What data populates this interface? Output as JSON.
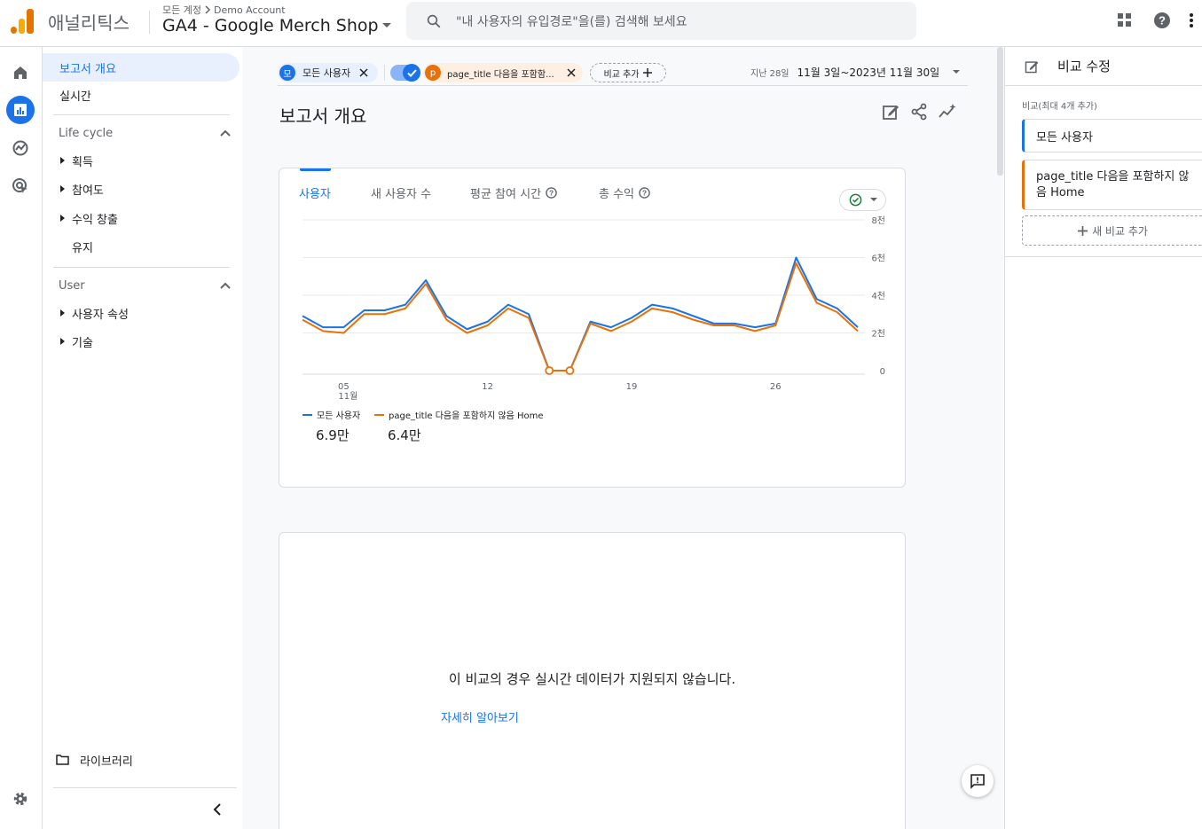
{
  "app": {
    "name": "애널리틱스"
  },
  "account": {
    "crumb_root": "모든 계정",
    "crumb_account": "Demo Account",
    "property": "GA4 - Google Merch Shop"
  },
  "search": {
    "placeholder": "\"내 사용자의 유입경로\"을(를) 검색해 보세요"
  },
  "nav": {
    "overview": "보고서 개요",
    "realtime": "실시간",
    "lifecycle": {
      "label": "Life cycle",
      "items": [
        "획득",
        "참여도",
        "수익 창출",
        "유지"
      ]
    },
    "user": {
      "label": "User",
      "items": [
        "사용자 속성",
        "기술"
      ]
    },
    "library": "라이브러리"
  },
  "chips": {
    "all_users_avatar": "모",
    "all_users": "모든 사용자",
    "page_avatar": "p",
    "page_filter": "page_title 다음을 포함함...",
    "add_compare": "비교 추가",
    "date_prefix": "지난 28일",
    "date_range": "11월 3일~2023년 11월 30일"
  },
  "page": {
    "title": "보고서 개요"
  },
  "tabs": [
    "사용자",
    "새 사용자 수",
    "평균 참여 시간",
    "총 수익"
  ],
  "chart_data": {
    "type": "line",
    "x_ticks": [
      {
        "day": 5,
        "label": "05",
        "sub": "11월"
      },
      {
        "day": 12,
        "label": "12",
        "sub": ""
      },
      {
        "day": 19,
        "label": "19",
        "sub": ""
      },
      {
        "day": 26,
        "label": "26",
        "sub": ""
      }
    ],
    "y_ticks": [
      {
        "value": 0,
        "label": "0"
      },
      {
        "value": 2000,
        "label": "2천"
      },
      {
        "value": 4000,
        "label": "4천"
      },
      {
        "value": 6000,
        "label": "6천"
      },
      {
        "value": 8000,
        "label": "8천"
      }
    ],
    "ylim": [
      0,
      8000
    ],
    "x": [
      3,
      4,
      5,
      6,
      7,
      8,
      9,
      10,
      11,
      12,
      13,
      14,
      15,
      16,
      17,
      18,
      19,
      20,
      21,
      22,
      23,
      24,
      25,
      26,
      27,
      28,
      29,
      30
    ],
    "series": [
      {
        "name": "모든 사용자",
        "color": "#1a73e8",
        "total": "6.9만",
        "values": [
          2900,
          2300,
          2300,
          3200,
          3200,
          3500,
          4800,
          2900,
          2200,
          2600,
          3500,
          3000,
          0,
          0,
          2600,
          2300,
          2800,
          3500,
          3300,
          2900,
          2500,
          2500,
          2300,
          2500,
          6000,
          3800,
          3300,
          2300
        ]
      },
      {
        "name": "page_title 다음을 포함하지 않음 Home",
        "color": "#e8710a",
        "total": "6.4만",
        "values": [
          2700,
          2100,
          2000,
          3000,
          3000,
          3300,
          4600,
          2700,
          2000,
          2400,
          3300,
          2800,
          0,
          0,
          2500,
          2100,
          2600,
          3300,
          3100,
          2700,
          2400,
          2400,
          2100,
          2400,
          5700,
          3600,
          3100,
          2100
        ]
      }
    ],
    "hollow_points": [
      15,
      16
    ]
  },
  "realtime": {
    "message": "이 비교의 경우 실시간 데이터가 지원되지 않습니다.",
    "learn_more": "자세히 알아보기"
  },
  "right_panel": {
    "title": "비교 수정",
    "subtitle": "비교(최대 4개 추가)",
    "items": [
      {
        "label": "모든 사용자",
        "color": "#1a73e8"
      },
      {
        "label": "page_title 다음을 포함하지 않음 Home",
        "color": "#e8710a"
      }
    ],
    "add_label": "새 비교 추가"
  },
  "colors": {
    "primary": "#1a73e8",
    "secondary": "#e8710a",
    "success": "#188038"
  }
}
